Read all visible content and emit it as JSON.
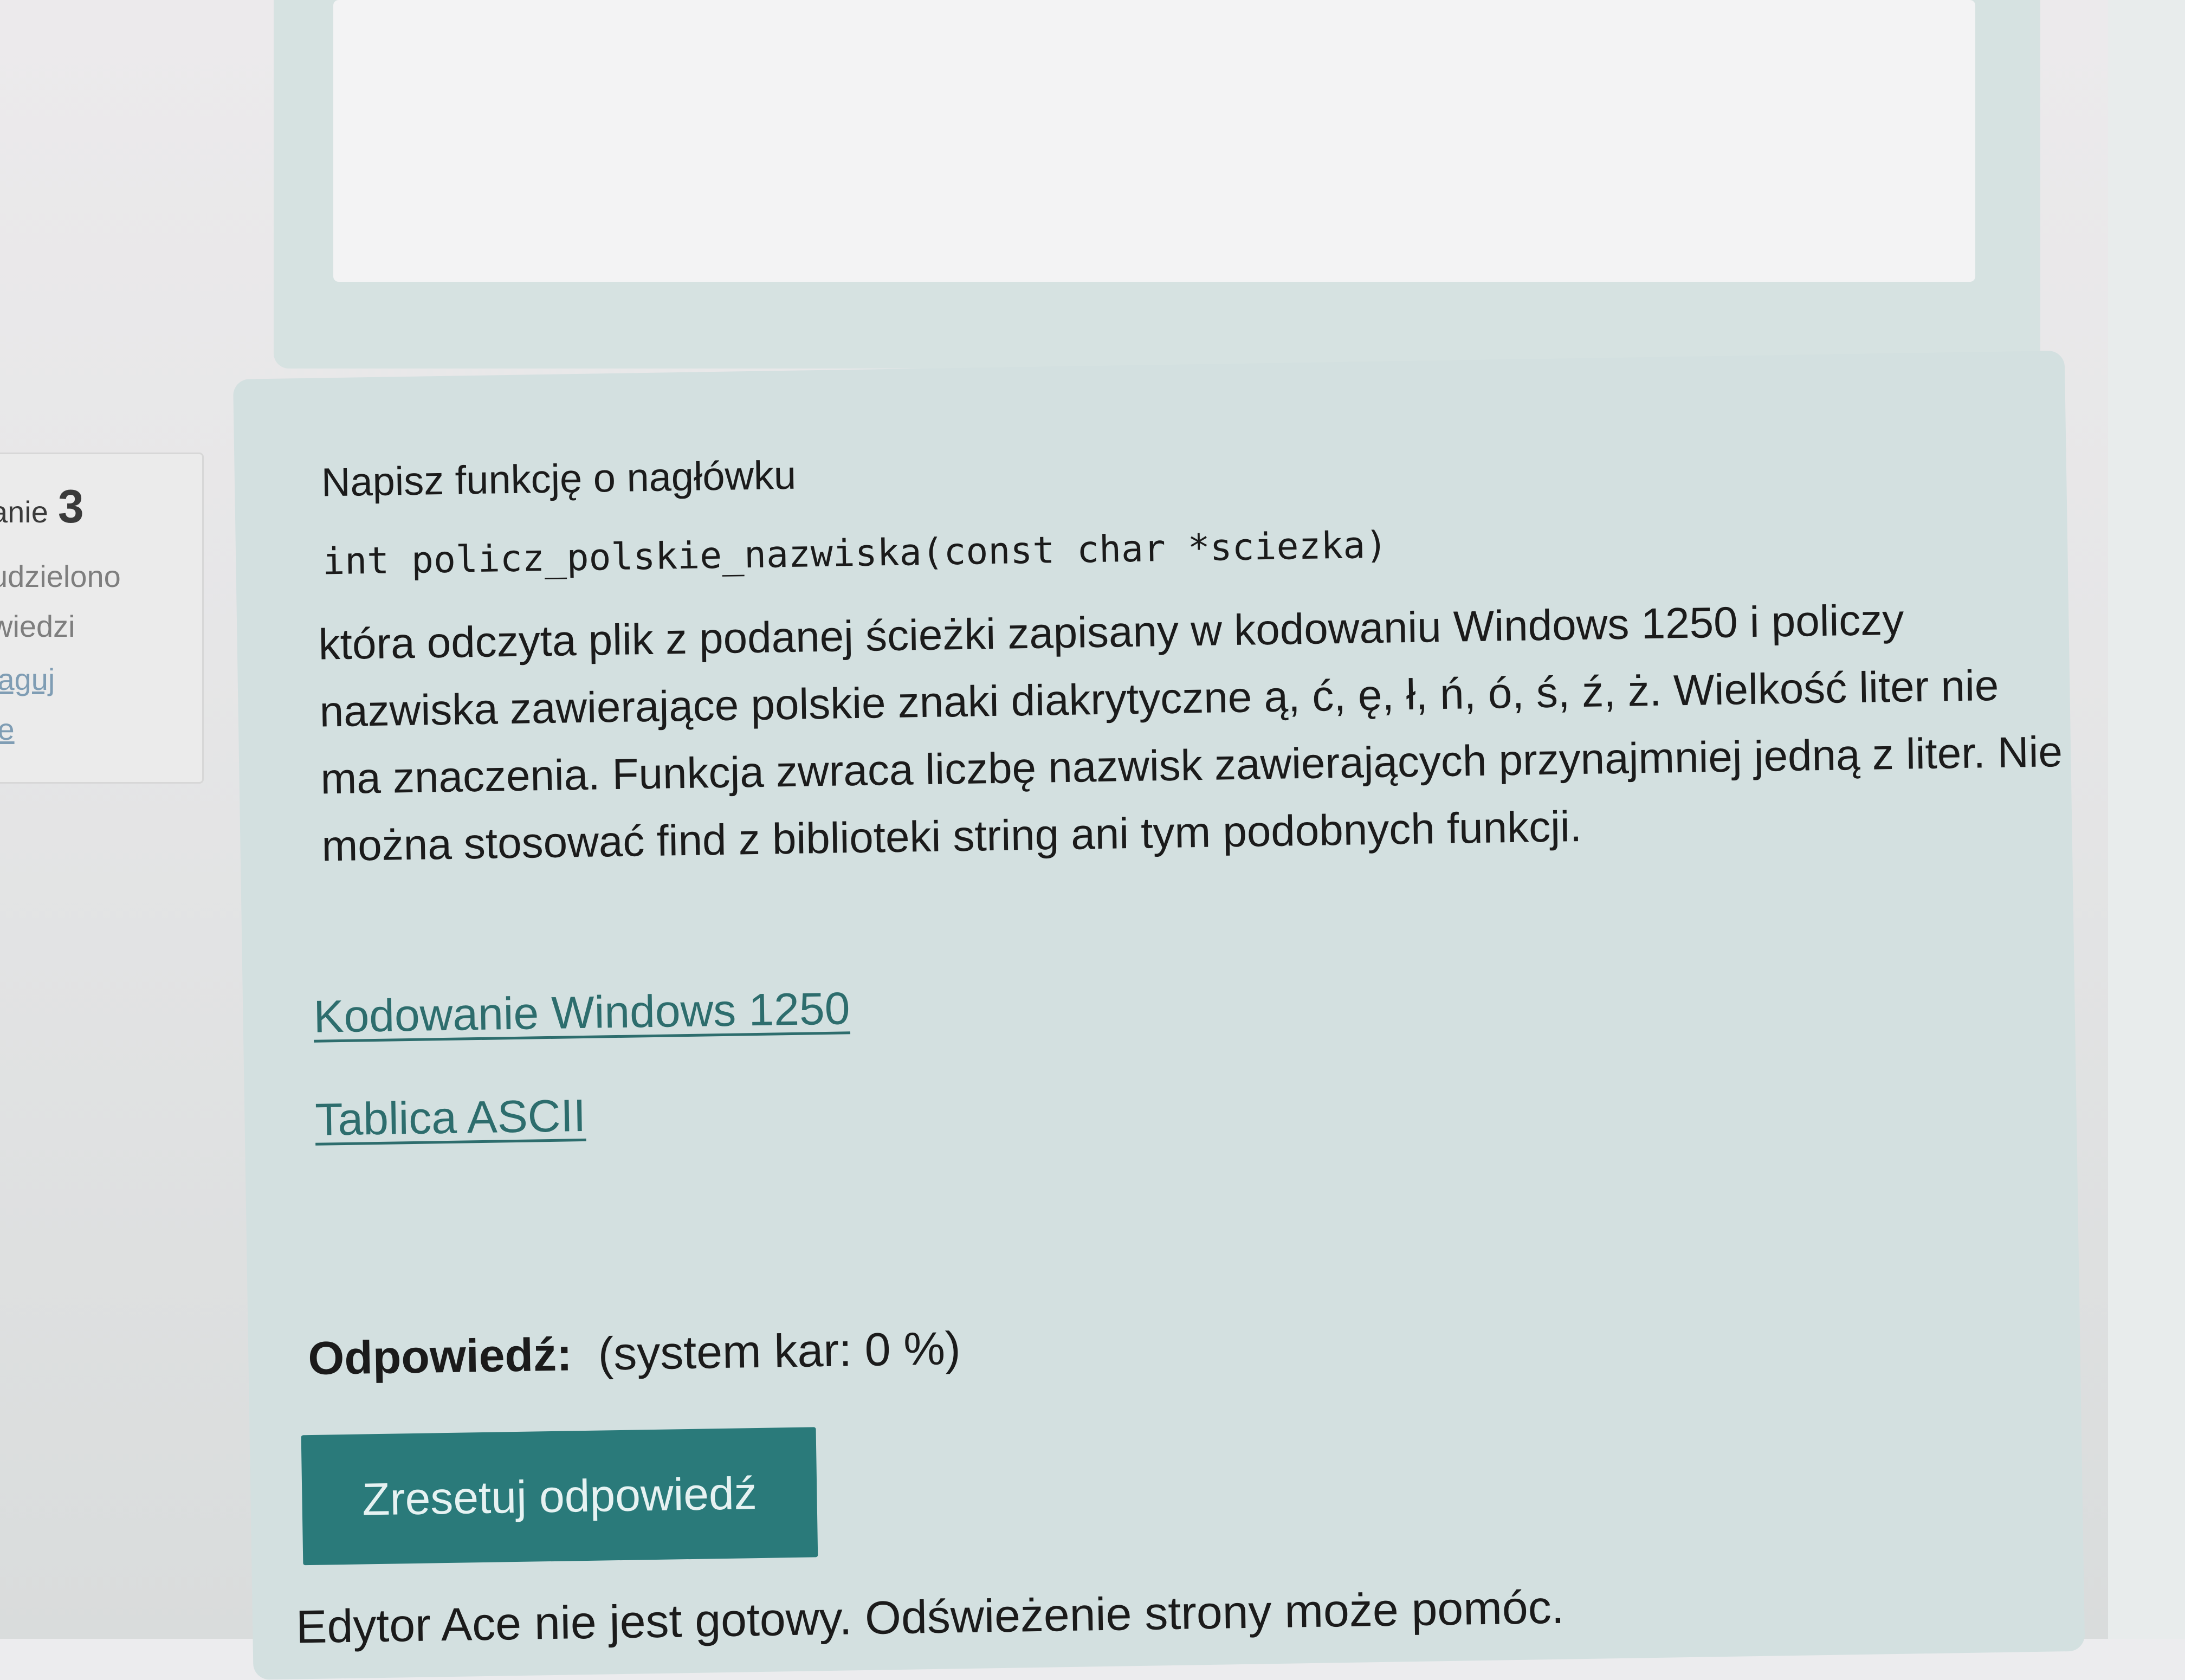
{
  "info_panel": {
    "title": "anie",
    "number": "3",
    "status_line1": "udzielono",
    "status_line2": "wiedzi",
    "flag_line1": "laguj",
    "flag_line2": "ie"
  },
  "question": {
    "heading": "Napisz funkcję o nagłówku",
    "code": "int policz_polskie_nazwiska(const char *sciezka)",
    "body": "która odczyta plik z podanej ścieżki zapisany w kodowaniu Windows 1250 i policzy nazwiska zawierające polskie znaki diakrytyczne ą, ć, ę, ł, ń, ó, ś, ź, ż. Wielkość liter nie ma znaczenia. Funkcja zwraca liczbę nazwisk zawierających przynajmniej jedną z liter. Nie można stosować find z biblioteki string ani tym podobnych funkcji.",
    "links": [
      "Kodowanie Windows 1250",
      "Tablica ASCII"
    ],
    "answer_label": "Odpowiedź:",
    "answer_penalty": "(system kar: 0 %)",
    "reset_button": "Zresetuj odpowiedź",
    "ace_note": "Edytor Ace nie jest gotowy. Odświeżenie strony może pomóc."
  },
  "colors": {
    "accent": "#2a7a7a",
    "link": "#2d6d6d",
    "question_bg": "#d3e0e0"
  }
}
